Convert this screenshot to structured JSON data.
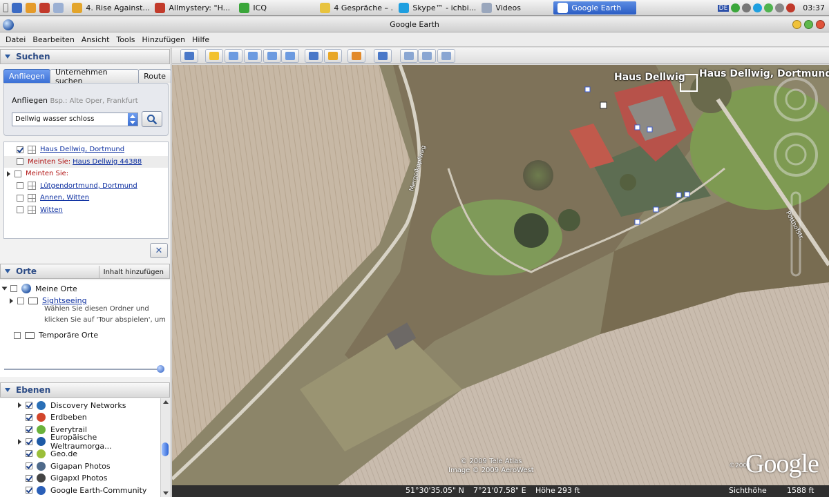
{
  "taskbar": {
    "tasks": [
      {
        "label": "4. Rise Against...",
        "icon": "music-player-icon",
        "color": "#e3a52b"
      },
      {
        "label": "Allmystery: \"H...",
        "icon": "opera-browser-icon",
        "color": "#c23b2b"
      },
      {
        "label": "ICQ",
        "icon": "icq-flower-icon",
        "color": "#3aa63a"
      },
      {
        "label": "4 Gespräche – ...",
        "icon": "chat-folder-icon",
        "color": "#e8c33e"
      },
      {
        "label": "Skype™ - ichbi...",
        "icon": "skype-icon",
        "color": "#1e9fe0"
      },
      {
        "label": "Videos",
        "icon": "folder-icon",
        "color": "#9aa7bd"
      },
      {
        "label": "Google Earth",
        "icon": "google-earth-icon",
        "color": "#ffffff"
      }
    ],
    "tray_badge": "DE",
    "clock": "03:37"
  },
  "window": {
    "title": "Google Earth"
  },
  "menu": [
    "Datei",
    "Bearbeiten",
    "Ansicht",
    "Tools",
    "Hinzufügen",
    "Hilfe"
  ],
  "search": {
    "header": "Suchen",
    "tabs": [
      "Anfliegen",
      "Unternehmen suchen",
      "Route"
    ],
    "fly_label": "Anfliegen",
    "fly_hint": "Bsp.: Alte Oper, Frankfurt",
    "query": "Dellwig wasser schloss",
    "results": [
      {
        "type": "place",
        "checked": true,
        "label": "Haus Dellwig, Dortmund"
      },
      {
        "type": "suggest",
        "prefix": "Meinten Sie:",
        "label": "Haus Dellwig 44388"
      },
      {
        "type": "group",
        "prefix": "Meinten Sie:"
      },
      {
        "type": "place",
        "checked": false,
        "label": "Lütgendortmund, Dortmund"
      },
      {
        "type": "place",
        "checked": false,
        "label": "Annen, Witten"
      },
      {
        "type": "place",
        "checked": false,
        "label": "Witten"
      }
    ],
    "close_glyph": "✕"
  },
  "orte": {
    "header": "Orte",
    "add_button": "Inhalt hinzufügen",
    "my_places": "Meine Orte",
    "sightseeing": "Sightseeing",
    "sightseeing_desc_1": "Wählen Sie diesen Ordner und",
    "sightseeing_desc_2": "klicken Sie auf 'Tour abspielen', um",
    "temp_places": "Temporäre Orte"
  },
  "ebenen": {
    "header": "Ebenen",
    "layers": [
      {
        "label": "Discovery Networks",
        "expand": true,
        "icon": "discovery-globe-icon",
        "color": "#2a6fb6"
      },
      {
        "label": "Erdbeben",
        "expand": false,
        "icon": "earthquake-icon",
        "color": "#d2452b"
      },
      {
        "label": "Everytrail",
        "expand": false,
        "icon": "everytrail-icon",
        "color": "#6ab23b"
      },
      {
        "label": "Europäische Weltraumorga...",
        "expand": true,
        "icon": "esa-icon",
        "color": "#1d5aa6"
      },
      {
        "label": "Geo.de",
        "expand": false,
        "icon": "geo-de-icon",
        "color": "#9bbf3a"
      },
      {
        "label": "Gigapan Photos",
        "expand": false,
        "icon": "gigapan-icon",
        "color": "#4f6a8a"
      },
      {
        "label": "Gigapxl Photos",
        "expand": false,
        "icon": "camera-icon",
        "color": "#444444"
      },
      {
        "label": "Google Earth-Community",
        "expand": false,
        "icon": "info-icon",
        "color": "#2a5fb8"
      }
    ]
  },
  "toolbar": {
    "tools": [
      {
        "name": "sidebar-toggle-tool",
        "color": "#4a78c8"
      },
      {
        "name": "placemark-tool",
        "color": "#f2c12e"
      },
      {
        "name": "polygon-tool",
        "color": "#6d9be0"
      },
      {
        "name": "path-tool",
        "color": "#6d9be0"
      },
      {
        "name": "image-overlay-tool",
        "color": "#6d9be0"
      },
      {
        "name": "record-tour-tool",
        "color": "#6d9be0"
      },
      {
        "name": "historical-imagery-tool",
        "color": "#4a78c8"
      },
      {
        "name": "sunlight-tool",
        "color": "#e8a726"
      },
      {
        "name": "planets-tool",
        "color": "#e28a2b"
      },
      {
        "name": "ruler-tool",
        "color": "#4a78c8"
      },
      {
        "name": "email-tool",
        "color": "#8aa6d2"
      },
      {
        "name": "print-tool",
        "color": "#8aa6d2"
      },
      {
        "name": "save-image-tool",
        "color": "#8aa6d2"
      }
    ]
  },
  "map": {
    "place_name": "Haus Dellwig",
    "place_name_full": "Haus Dellwig, Dortmund",
    "road_1": "Mergelkopfweg",
    "road_2": "Potthofstr.",
    "copyright_1": "© 2009 Tele Atlas",
    "copyright_2": "Image © 2009 AeroWest",
    "google_year": "©2009",
    "google": "Google"
  },
  "status": {
    "lat": "51°30'35.05\" N",
    "lon": "7°21'07.58\" E",
    "elev_label": "Höhe",
    "elev": "293 ft",
    "eye_label": "Sichthöhe",
    "eye": "1588 ft"
  }
}
